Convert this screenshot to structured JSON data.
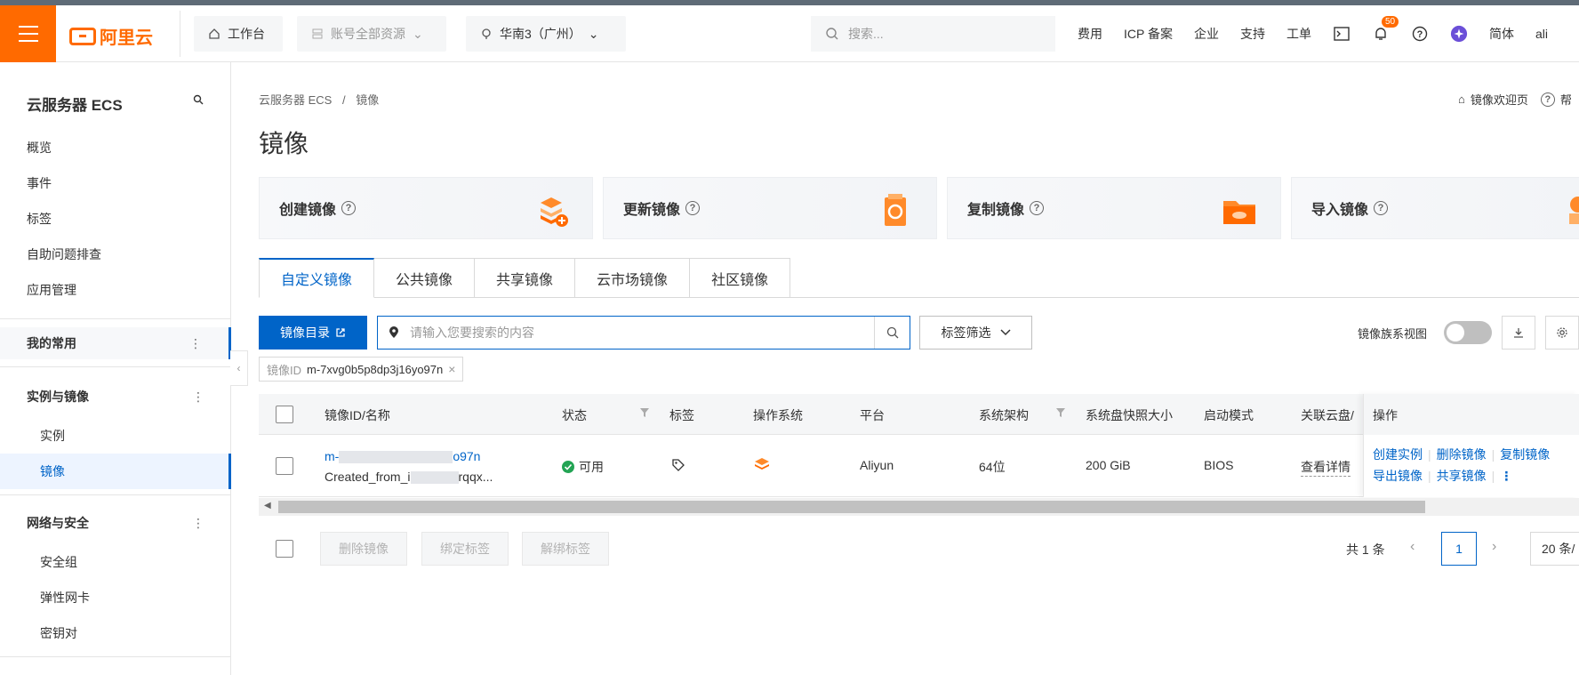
{
  "topbar": {
    "brand": "阿里云",
    "workbench": "工作台",
    "resources": "账号全部资源",
    "region": "华南3（广州）",
    "search_placeholder": "搜索...",
    "links": [
      "费用",
      "ICP 备案",
      "企业",
      "支持",
      "工单"
    ],
    "notif_count": "50",
    "lang": "简体",
    "user_initial": "ali"
  },
  "sidebar": {
    "title": "云服务器 ECS",
    "items": [
      "概览",
      "事件",
      "标签",
      "自助问题排查",
      "应用管理"
    ],
    "group_favorites": "我的常用",
    "group_instances": "实例与镜像",
    "sub_instance": "实例",
    "sub_image": "镜像",
    "group_network": "网络与安全",
    "sub_network": [
      "安全组",
      "弹性网卡",
      "密钥对"
    ]
  },
  "breadcrumb": {
    "root": "云服务器 ECS",
    "sep": "/",
    "current": "镜像"
  },
  "page": {
    "title": "镜像",
    "welcome": "镜像欢迎页",
    "help": "帮"
  },
  "actions": [
    "创建镜像",
    "更新镜像",
    "复制镜像",
    "导入镜像"
  ],
  "tabs": [
    "自定义镜像",
    "公共镜像",
    "共享镜像",
    "云市场镜像",
    "社区镜像"
  ],
  "toolbar": {
    "catalog_btn": "镜像目录",
    "search_placeholder": "请输入您要搜索的内容",
    "tag_filter": "标签筛选",
    "family_view": "镜像族系视图",
    "family_view_on": false
  },
  "filter_chip": {
    "key": "镜像ID",
    "value": "m-7xvg0b5p8dp3j16yo97n"
  },
  "table": {
    "headers": [
      "镜像ID/名称",
      "状态",
      "标签",
      "操作系统",
      "平台",
      "系统架构",
      "系统盘快照大小",
      "启动模式",
      "关联云盘/",
      "操作"
    ],
    "rows": [
      {
        "id_prefix": "m-",
        "id_suffix": "o97n",
        "name_prefix": "Created_from_i",
        "name_suffix": "rqqx...",
        "status": "可用",
        "platform": "Aliyun",
        "arch": "64位",
        "size": "200 GiB",
        "boot": "BIOS",
        "disk": "查看详情",
        "ops": [
          "创建实例",
          "删除镜像",
          "复制镜像",
          "导出镜像",
          "共享镜像"
        ]
      }
    ]
  },
  "footer": {
    "buttons": [
      "删除镜像",
      "绑定标签",
      "解绑标签"
    ],
    "total": "共 1 条",
    "current_page": "1",
    "page_size": "20 条/"
  },
  "colors": {
    "accent": "#0064c8",
    "brand": "#ff6a00",
    "success": "#23a454"
  }
}
